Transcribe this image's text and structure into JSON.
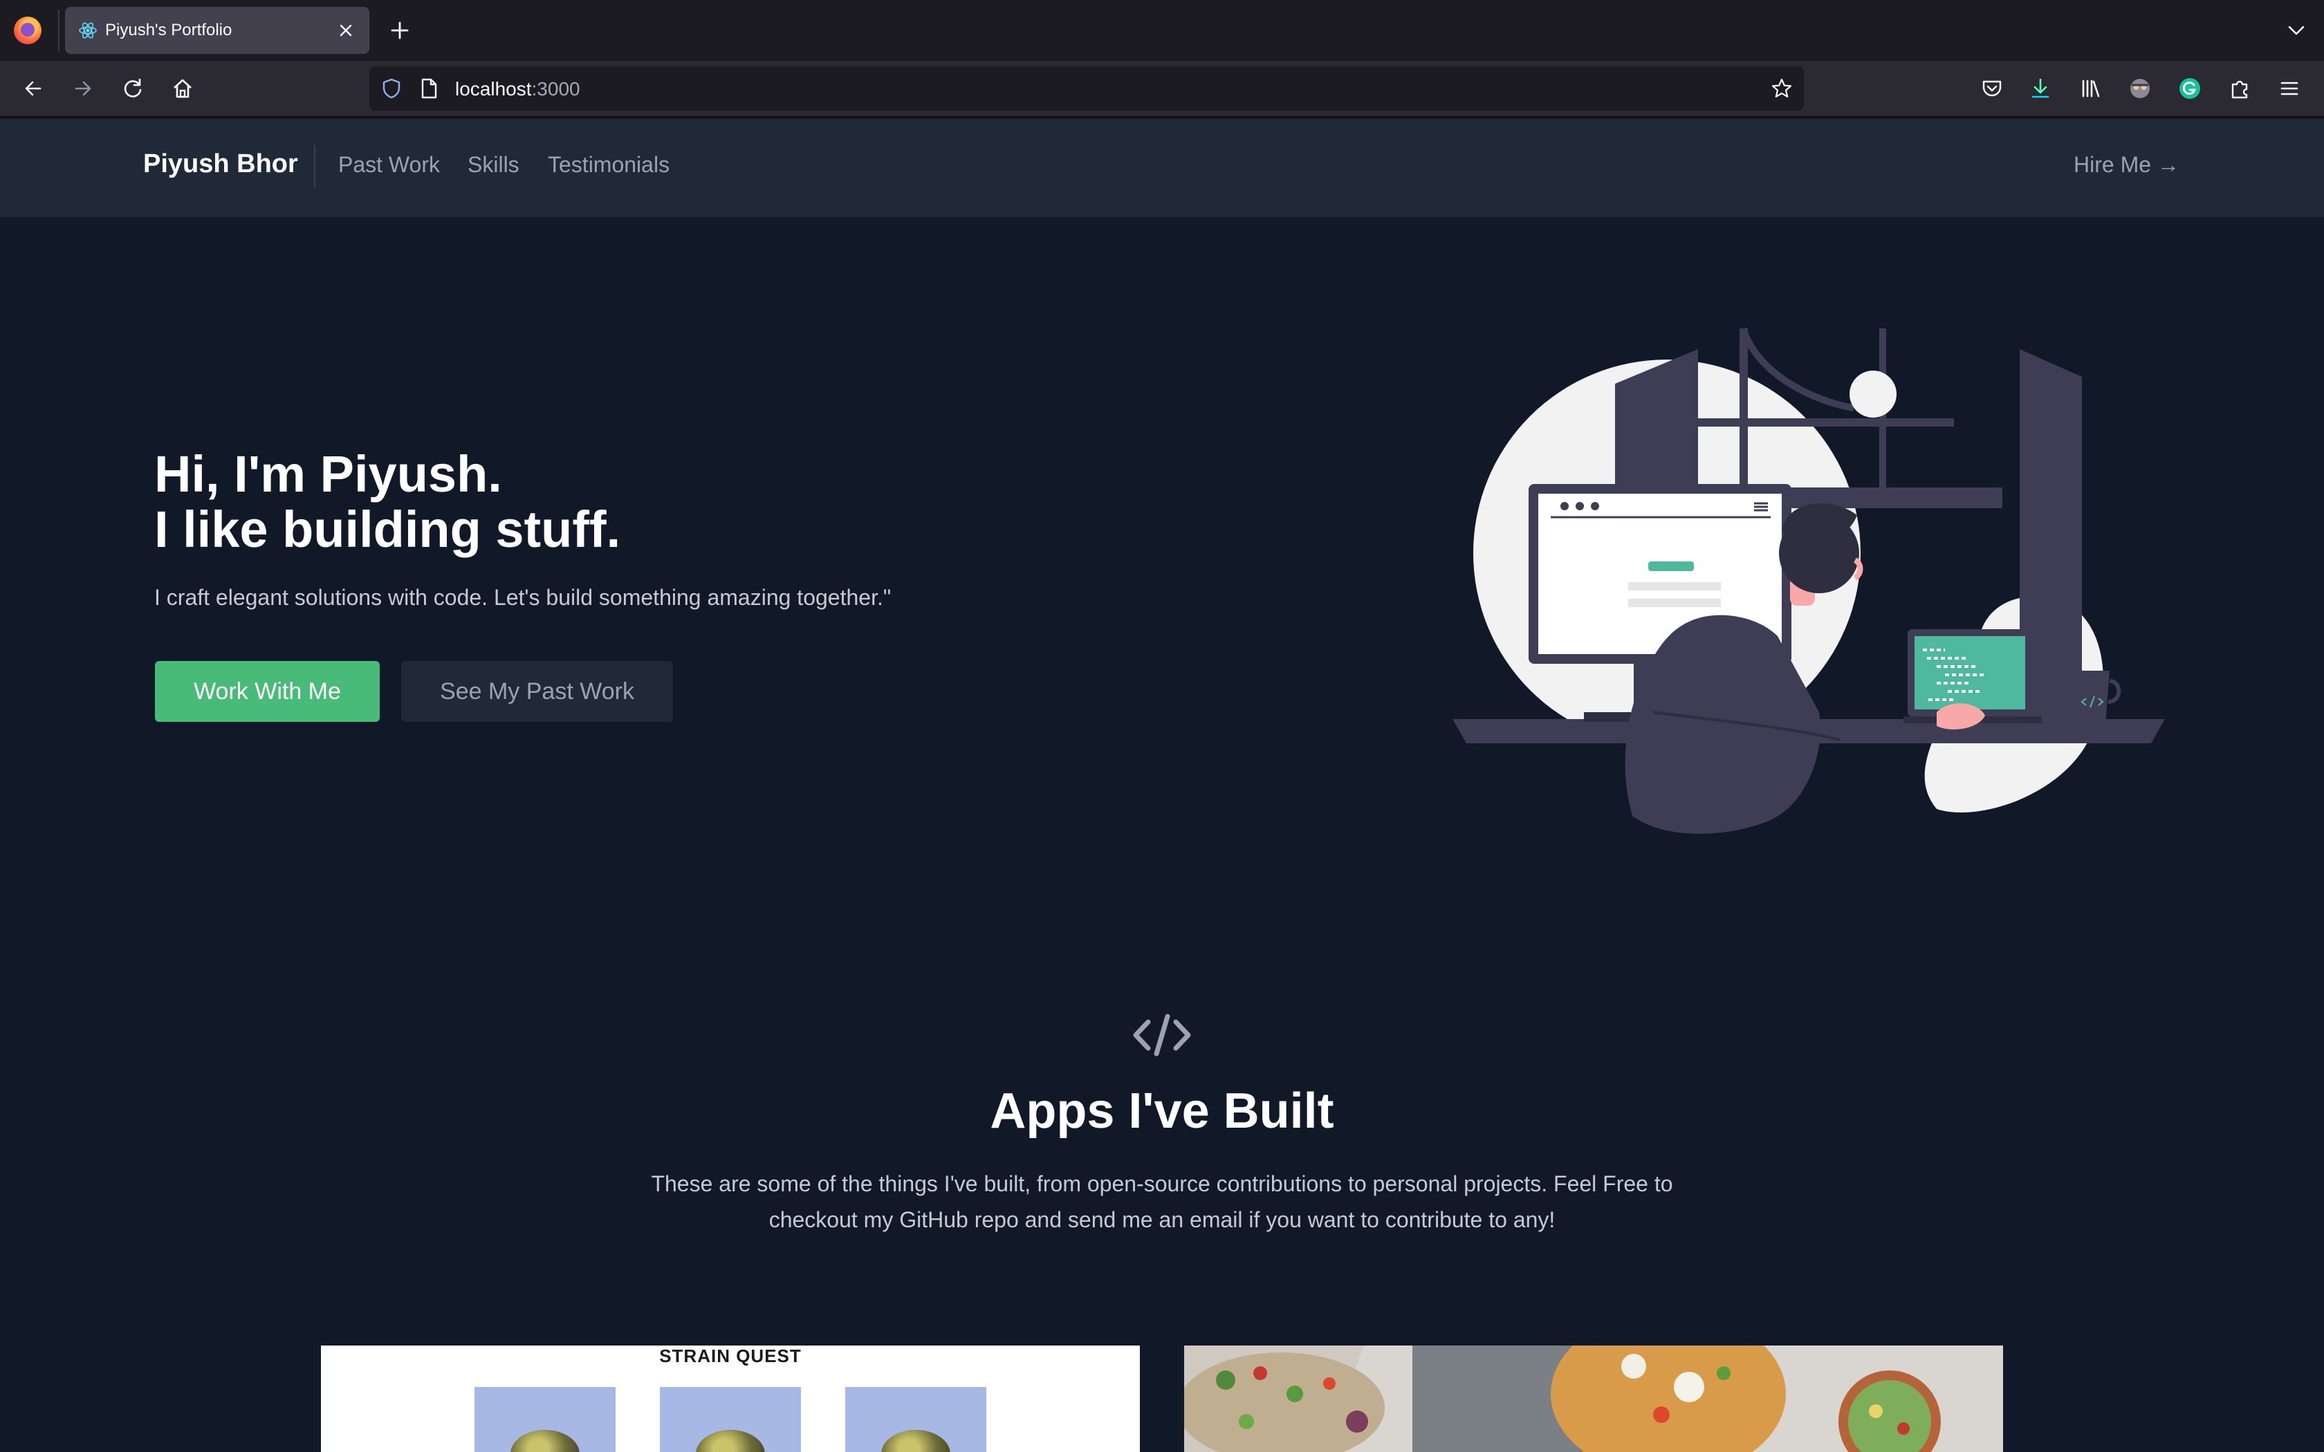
{
  "browser": {
    "tab_title": "Piyush's Portfolio",
    "url_host": "localhost",
    "url_port": ":3000"
  },
  "header": {
    "brand": "Piyush Bhor",
    "nav": [
      "Past Work",
      "Skills",
      "Testimonials"
    ],
    "cta": "Hire Me →"
  },
  "hero": {
    "title_line1": "Hi, I'm Piyush.",
    "title_line2": "I like building stuff.",
    "subtitle": "I craft elegant solutions with code. Let's build something amazing together.\"",
    "primary_button": "Work With Me",
    "secondary_button": "See My Past Work"
  },
  "projects": {
    "title": "Apps I've Built",
    "description": "These are some of the things I've built, from open-source contributions to personal projects. Feel Free to checkout my GitHub repo and send me an email if you want to contribute to any!",
    "cards": [
      {
        "title": "STRAIN QUEST"
      }
    ]
  },
  "colors": {
    "page_bg": "#111827",
    "header_bg": "#1f2937",
    "accent_green": "#48bb78",
    "code_green": "#4fb99f"
  },
  "icons": [
    "firefox-logo-icon",
    "react-favicon-icon",
    "close-icon",
    "plus-icon",
    "chevron-down-icon",
    "back-icon",
    "forward-icon",
    "reload-icon",
    "home-icon",
    "shield-icon",
    "page-icon",
    "star-icon",
    "pocket-icon",
    "download-icon",
    "library-icon",
    "account-icon",
    "grammarly-icon",
    "extensions-icon",
    "menu-icon",
    "code-icon"
  ]
}
